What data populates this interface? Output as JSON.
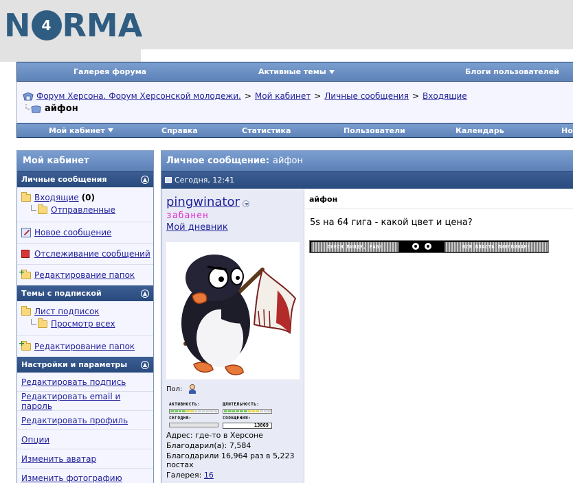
{
  "logo": {
    "text_left": "N",
    "text_circle": "4",
    "text_right": "RMA"
  },
  "nav_top": {
    "items": [
      {
        "label": "Галерея форума",
        "dropdown": false
      },
      {
        "label": "Активные темы",
        "dropdown": true
      },
      {
        "label": "Блоги пользователей",
        "dropdown": false
      }
    ]
  },
  "breadcrumb": {
    "items": [
      "Форум Херсона. Форум Херсонской молодежи.",
      "Мой кабинет",
      "Личные сообщения",
      "Входящие"
    ],
    "separator": ">",
    "current": "айфон"
  },
  "nav_bottom": {
    "items": [
      {
        "label": "Мой кабинет",
        "dropdown": true
      },
      {
        "label": "Справка",
        "dropdown": false
      },
      {
        "label": "Статистика",
        "dropdown": false
      },
      {
        "label": "Пользователи",
        "dropdown": false
      },
      {
        "label": "Календарь",
        "dropdown": false
      },
      {
        "label": "Но",
        "dropdown": false
      }
    ]
  },
  "sidebar": {
    "title": "Мой кабинет",
    "sections": {
      "messages": {
        "title": "Личные сообщения",
        "inbox_label": "Входящие",
        "inbox_count": "(0)",
        "sent_label": "Отправленные",
        "new_message": "Новое сообщение",
        "tracking": "Отслеживание сообщений",
        "edit_folders": "Редактирование папок"
      },
      "subscriptions": {
        "title": "Темы с подпиской",
        "list_label": "Лист подписок",
        "view_all": "Просмотр всех",
        "edit_folders": "Редактирование папок"
      },
      "settings": {
        "title": "Настройки и параметры",
        "items": [
          "Редактировать подпись",
          "Редактировать email и пароль",
          "Редактировать профиль",
          "Опции",
          "Изменить аватар",
          "Изменить фотографию"
        ]
      }
    }
  },
  "message": {
    "panel_title_label": "Личное сообщение",
    "panel_title_colon": ":",
    "panel_title_value": "айфон",
    "date": "Сегодня, 12:41",
    "subject": "айфон",
    "body": "5s на 64 гига - какой цвет и цена?",
    "signature": {
      "left_text": "СНЕСИ ВИНДУ, FAG!",
      "right_text": "ВСЯ ВЛАСТЬ ПИНГВИНАМ!"
    }
  },
  "user": {
    "name": "pingwinator",
    "status": "забанен",
    "diary": "Мой дневник",
    "gender_label": "Пол:",
    "stats": {
      "activity_label": "АКТИВНОСТЬ:",
      "duration_label": "ДЛИТЕЛЬНОСТЬ:",
      "today_label": "СЕГОДНЯ:",
      "posts_label": "СООБЩЕНИЯ:",
      "posts_count": "13869"
    },
    "address": "Адрес: где-то в Херсоне",
    "thanked": "Благодарил(а): 7,584",
    "thanked_by": "Благодарили 16,964 раз в 5,223 постах",
    "gallery_label": "Галерея:",
    "gallery_count": "16"
  },
  "colors": {
    "nav_blue": "#6a8fc4",
    "category_dark": "#2f5289",
    "link": "#22229c",
    "status_banned": "#e22ad1",
    "logo": "#2f5d82"
  }
}
